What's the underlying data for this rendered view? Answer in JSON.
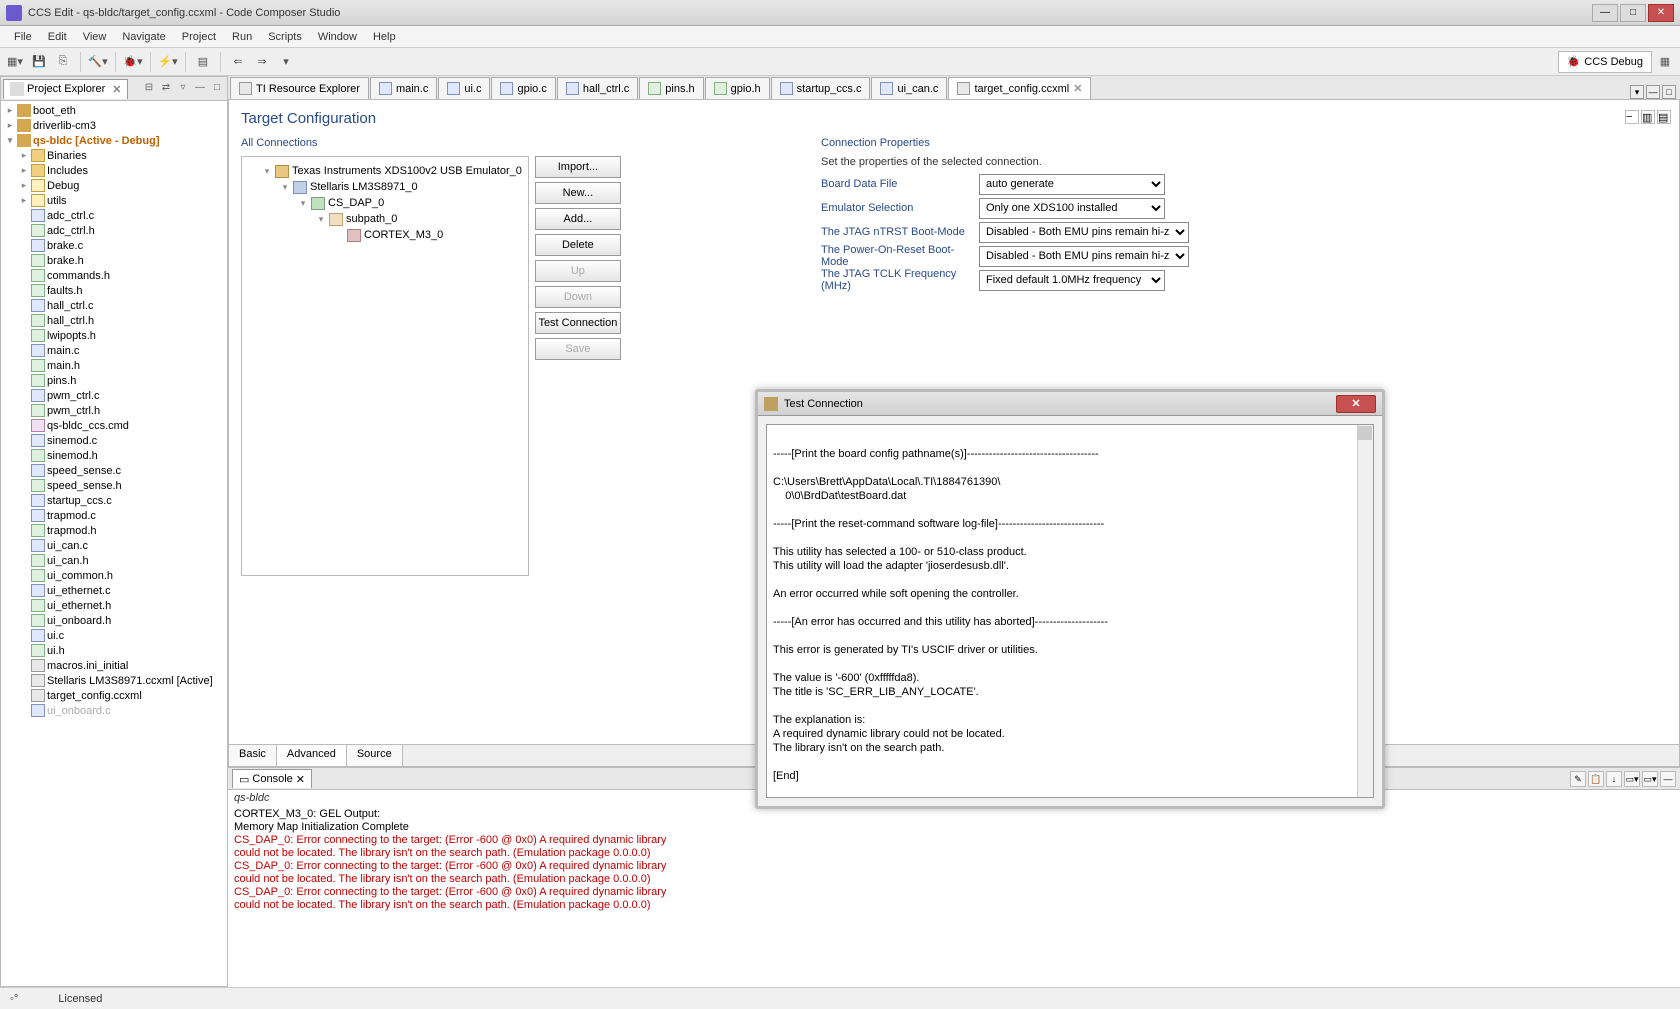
{
  "window": {
    "title": "CCS Edit - qs-bldc/target_config.ccxml - Code Composer Studio"
  },
  "menu": [
    "File",
    "Edit",
    "View",
    "Navigate",
    "Project",
    "Run",
    "Scripts",
    "Window",
    "Help"
  ],
  "perspective": "CCS Debug",
  "project_explorer": {
    "title": "Project Explorer",
    "items": [
      {
        "lvl": 0,
        "tw": "▸",
        "ico": "prj",
        "label": "boot_eth"
      },
      {
        "lvl": 0,
        "tw": "▸",
        "ico": "prj",
        "label": "driverlib-cm3"
      },
      {
        "lvl": 0,
        "tw": "▾",
        "ico": "prj",
        "label": "qs-bldc  [Active - Debug]",
        "active": true
      },
      {
        "lvl": 1,
        "tw": "▸",
        "ico": "fold",
        "label": "Binaries"
      },
      {
        "lvl": 1,
        "tw": "▸",
        "ico": "fold",
        "label": "Includes"
      },
      {
        "lvl": 1,
        "tw": "▸",
        "ico": "foldopen",
        "label": "Debug"
      },
      {
        "lvl": 1,
        "tw": "▸",
        "ico": "foldopen",
        "label": "utils"
      },
      {
        "lvl": 1,
        "tw": "",
        "ico": "c",
        "label": "adc_ctrl.c"
      },
      {
        "lvl": 1,
        "tw": "",
        "ico": "h",
        "label": "adc_ctrl.h"
      },
      {
        "lvl": 1,
        "tw": "",
        "ico": "c",
        "label": "brake.c"
      },
      {
        "lvl": 1,
        "tw": "",
        "ico": "h",
        "label": "brake.h"
      },
      {
        "lvl": 1,
        "tw": "",
        "ico": "h",
        "label": "commands.h"
      },
      {
        "lvl": 1,
        "tw": "",
        "ico": "h",
        "label": "faults.h"
      },
      {
        "lvl": 1,
        "tw": "",
        "ico": "c",
        "label": "hall_ctrl.c"
      },
      {
        "lvl": 1,
        "tw": "",
        "ico": "h",
        "label": "hall_ctrl.h"
      },
      {
        "lvl": 1,
        "tw": "",
        "ico": "h",
        "label": "lwipopts.h"
      },
      {
        "lvl": 1,
        "tw": "",
        "ico": "c",
        "label": "main.c"
      },
      {
        "lvl": 1,
        "tw": "",
        "ico": "h",
        "label": "main.h"
      },
      {
        "lvl": 1,
        "tw": "",
        "ico": "h",
        "label": "pins.h"
      },
      {
        "lvl": 1,
        "tw": "",
        "ico": "c",
        "label": "pwm_ctrl.c"
      },
      {
        "lvl": 1,
        "tw": "",
        "ico": "h",
        "label": "pwm_ctrl.h"
      },
      {
        "lvl": 1,
        "tw": "",
        "ico": "cmd",
        "label": "qs-bldc_ccs.cmd"
      },
      {
        "lvl": 1,
        "tw": "",
        "ico": "c",
        "label": "sinemod.c"
      },
      {
        "lvl": 1,
        "tw": "",
        "ico": "h",
        "label": "sinemod.h"
      },
      {
        "lvl": 1,
        "tw": "",
        "ico": "c",
        "label": "speed_sense.c"
      },
      {
        "lvl": 1,
        "tw": "",
        "ico": "h",
        "label": "speed_sense.h"
      },
      {
        "lvl": 1,
        "tw": "",
        "ico": "c",
        "label": "startup_ccs.c"
      },
      {
        "lvl": 1,
        "tw": "",
        "ico": "c",
        "label": "trapmod.c"
      },
      {
        "lvl": 1,
        "tw": "",
        "ico": "h",
        "label": "trapmod.h"
      },
      {
        "lvl": 1,
        "tw": "",
        "ico": "c",
        "label": "ui_can.c"
      },
      {
        "lvl": 1,
        "tw": "",
        "ico": "h",
        "label": "ui_can.h"
      },
      {
        "lvl": 1,
        "tw": "",
        "ico": "h",
        "label": "ui_common.h"
      },
      {
        "lvl": 1,
        "tw": "",
        "ico": "c",
        "label": "ui_ethernet.c"
      },
      {
        "lvl": 1,
        "tw": "",
        "ico": "h",
        "label": "ui_ethernet.h"
      },
      {
        "lvl": 1,
        "tw": "",
        "ico": "h",
        "label": "ui_onboard.h"
      },
      {
        "lvl": 1,
        "tw": "",
        "ico": "c",
        "label": "ui.c"
      },
      {
        "lvl": 1,
        "tw": "",
        "ico": "h",
        "label": "ui.h"
      },
      {
        "lvl": 1,
        "tw": "",
        "ico": "xml",
        "label": "macros.ini_initial"
      },
      {
        "lvl": 1,
        "tw": "",
        "ico": "xml",
        "label": "Stellaris LM3S8971.ccxml [Active]"
      },
      {
        "lvl": 1,
        "tw": "",
        "ico": "xml",
        "label": "target_config.ccxml"
      },
      {
        "lvl": 1,
        "tw": "",
        "ico": "c",
        "label": "ui_onboard.c",
        "dim": true
      }
    ]
  },
  "tabs": [
    {
      "ico": "xml",
      "label": "TI Resource Explorer"
    },
    {
      "ico": "c",
      "label": "main.c"
    },
    {
      "ico": "c",
      "label": "ui.c"
    },
    {
      "ico": "c",
      "label": "gpio.c"
    },
    {
      "ico": "c",
      "label": "hall_ctrl.c"
    },
    {
      "ico": "h",
      "label": "pins.h"
    },
    {
      "ico": "h",
      "label": "gpio.h"
    },
    {
      "ico": "c",
      "label": "startup_ccs.c"
    },
    {
      "ico": "c",
      "label": "ui_can.c"
    },
    {
      "ico": "xml",
      "label": "target_config.ccxml",
      "active": true
    }
  ],
  "target_config": {
    "title": "Target Configuration",
    "all_connections": "All Connections",
    "tree": [
      {
        "lvl": 0,
        "tw": "▾",
        "ico": "conn",
        "label": "Texas Instruments XDS100v2 USB Emulator_0"
      },
      {
        "lvl": 1,
        "tw": "▾",
        "ico": "dev",
        "label": "Stellaris LM3S8971_0"
      },
      {
        "lvl": 2,
        "tw": "▾",
        "ico": "dap",
        "label": "CS_DAP_0"
      },
      {
        "lvl": 3,
        "tw": "▾",
        "ico": "sub",
        "label": "subpath_0"
      },
      {
        "lvl": 4,
        "tw": "",
        "ico": "core",
        "label": "CORTEX_M3_0"
      }
    ],
    "buttons": {
      "import": "Import...",
      "new": "New...",
      "add": "Add...",
      "delete": "Delete",
      "up": "Up",
      "down": "Down",
      "test": "Test Connection",
      "save": "Save"
    },
    "bottom_tabs": [
      "Basic",
      "Advanced",
      "Source"
    ],
    "conn_props": {
      "title": "Connection Properties",
      "desc": "Set the properties of the selected connection.",
      "rows": [
        {
          "label": "Board Data File",
          "value": "auto generate"
        },
        {
          "label": "Emulator Selection",
          "value": "Only one XDS100 installed"
        },
        {
          "label": "The JTAG nTRST Boot-Mode",
          "value": "Disabled - Both EMU pins remain hi-z"
        },
        {
          "label": "The Power-On-Reset Boot-Mode",
          "value": "Disabled - Both EMU pins remain hi-z"
        },
        {
          "label": "The JTAG TCLK Frequency (MHz)",
          "value": "Fixed default 1.0MHz frequency"
        }
      ]
    }
  },
  "console": {
    "title": "Console",
    "subtitle": "qs-bldc",
    "lines": [
      {
        "t": "CORTEX_M3_0: GEL Output:"
      },
      {
        "t": "Memory Map Initialization Complete"
      },
      {
        "t": "CS_DAP_0: Error connecting to the target: (Error -600 @ 0x0) A required dynamic library",
        "err": true
      },
      {
        "t": "could not be located. The library isn't on the search path. (Emulation package 0.0.0.0)",
        "err": true
      },
      {
        "t": "CS_DAP_0: Error connecting to the target: (Error -600 @ 0x0) A required dynamic library",
        "err": true
      },
      {
        "t": "could not be located. The library isn't on the search path. (Emulation package 0.0.0.0)",
        "err": true
      },
      {
        "t": "CS_DAP_0: Error connecting to the target: (Error -600 @ 0x0) A required dynamic library",
        "err": true
      },
      {
        "t": "could not be located. The library isn't on the search path. (Emulation package 0.0.0.0)",
        "err": true
      }
    ]
  },
  "modal": {
    "title": "Test Connection",
    "body": "\n-----[Print the board config pathname(s)]------------------------------------\n\nC:\\Users\\Brett\\AppData\\Local\\.TI\\1884761390\\\n    0\\0\\BrdDat\\testBoard.dat\n\n-----[Print the reset-command software log-file]-----------------------------\n\nThis utility has selected a 100- or 510-class product.\nThis utility will load the adapter 'jioserdesusb.dll'.\n\nAn error occurred while soft opening the controller.\n\n-----[An error has occurred and this utility has aborted]--------------------\n\nThis error is generated by TI's USCIF driver or utilities.\n\nThe value is '-600' (0xfffffda8).\nThe title is 'SC_ERR_LIB_ANY_LOCATE'.\n\nThe explanation is:\nA required dynamic library could not be located.\nThe library isn't on the search path.\n\n[End]\n"
  },
  "status": {
    "license": "Licensed"
  }
}
